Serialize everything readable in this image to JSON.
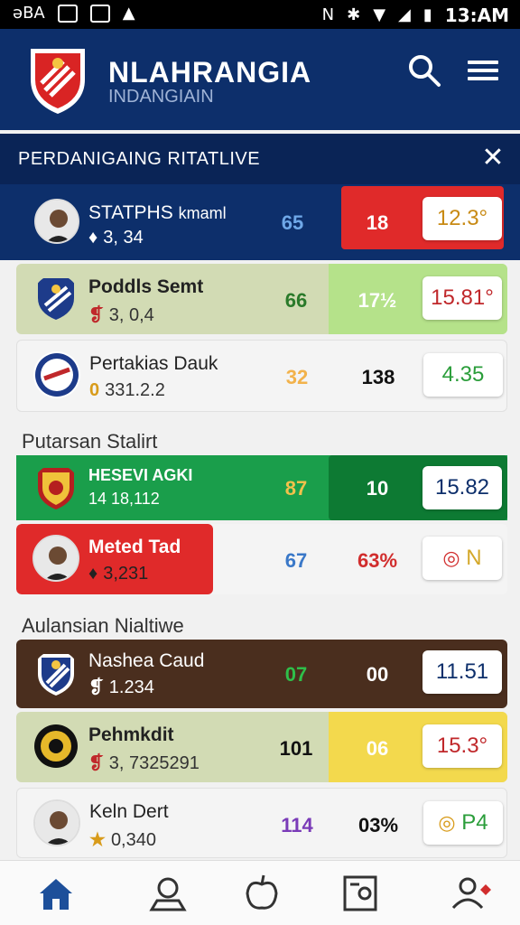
{
  "status": {
    "left": "əBA",
    "time": "13:AM"
  },
  "app": {
    "title": "NLAHRANGIA",
    "subtitle": "INDANGIAIN"
  },
  "section": {
    "title": "PERDANIGAING RITATLIVE"
  },
  "rows_top": [
    {
      "name": "STATPHS",
      "extra": "kmaml",
      "sub_mark": "♦",
      "sub": "3, 34",
      "v1": "65",
      "v2": "18",
      "pill": "12.3°"
    },
    {
      "name": "Poddls Semt",
      "sub_mark": "❡",
      "sub": "3, 0,4",
      "v1": "66",
      "v2": "17½",
      "pill": "15.81°"
    },
    {
      "name": "Pertakias Dauk",
      "sub_mark": "0",
      "sub": "331.2.2",
      "v1": "32",
      "v2": "138",
      "pill": "4.35"
    }
  ],
  "group1": {
    "label": "Putarsan Stalirt"
  },
  "rows_mid": [
    {
      "name": "HESEVI AGKI",
      "sub": "14 18,112",
      "v1": "87",
      "v2": "10",
      "pill": "15.82"
    },
    {
      "name": "Meted Tad",
      "sub_mark": "♦",
      "sub": "3,231",
      "v1": "67",
      "v2": "63%",
      "pill": "N"
    }
  ],
  "group2": {
    "label": "Aulansian Nialtiwe"
  },
  "rows_bot": [
    {
      "name": "Nashea Caud",
      "sub_mark": "❡",
      "sub": "1.234",
      "v1": "07",
      "v2": "00",
      "pill": "11.51"
    },
    {
      "name": "Pehmkdit",
      "sub_mark": "❡",
      "sub": "3, 7325291",
      "v1": "101",
      "v2": "06",
      "pill": "15.3°"
    },
    {
      "name": "Keln Dert",
      "sub_mark": "★",
      "sub": "0,340",
      "v1": "114",
      "v2": "03%",
      "pill": "P4"
    }
  ],
  "colors": {
    "navy": "#0d2f6b",
    "red": "#e02a2a",
    "lime": "#b5e28a",
    "green": "#1a9e4b",
    "darkgreen": "#0d7a33",
    "brown": "#4a2e1e",
    "yellow": "#f3d94d",
    "sage": "#d2dbb4"
  },
  "nav_icons": [
    "home-icon",
    "scoreboard-icon",
    "apple-icon",
    "stats-icon",
    "profile-icon"
  ]
}
